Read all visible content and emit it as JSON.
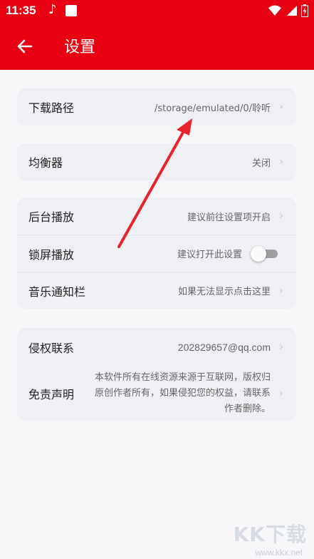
{
  "status_bar": {
    "time": "11:35",
    "icons": [
      "music-note-icon",
      "square-icon",
      "wifi-icon",
      "signal-icon",
      "battery-icon"
    ]
  },
  "app_bar": {
    "title": "设置",
    "back_icon": "arrow-left-icon"
  },
  "settings": {
    "download_path": {
      "label": "下载路径",
      "value": "/storage/emulated/0/聆听"
    },
    "equalizer": {
      "label": "均衡器",
      "value": "关闭"
    },
    "background_play": {
      "label": "后台播放",
      "value": "建议前往设置项开启"
    },
    "lockscreen_play": {
      "label": "锁屏播放",
      "value": "建议打开此设置",
      "enabled": false
    },
    "music_notification": {
      "label": "音乐通知栏",
      "value": "如果无法显示点击这里"
    },
    "copyright_contact": {
      "label": "侵权联系",
      "value": "202829657@qq.com"
    },
    "disclaimer": {
      "label": "免责声明",
      "value": "本软件所有在线资源来源于互联网，版权归原创作者所有，如果侵犯您的权益，请联系作者删除。"
    }
  },
  "annotation": {
    "color": "#e8232c",
    "icon": "red-arrow-annotation"
  },
  "colors": {
    "accent": "#e60012",
    "card_bg": "#eef0f4",
    "page_bg": "#f7f7f9"
  },
  "watermark": {
    "logo": "KK下载",
    "url": "www.kkx.net"
  }
}
